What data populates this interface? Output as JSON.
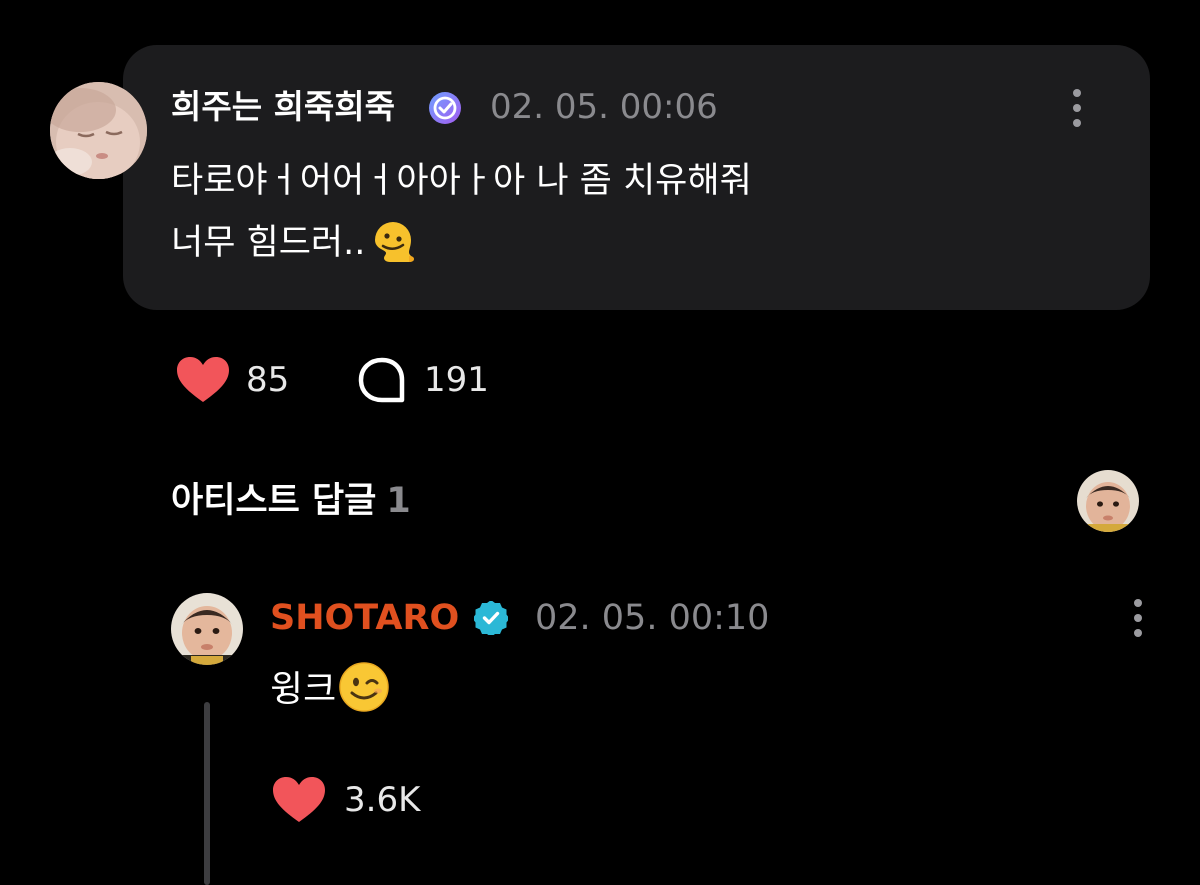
{
  "post": {
    "author": "희주는 희죽희죽",
    "verified_icon": "verified-badge-icon",
    "verified_color": "#7c6cf5",
    "timestamp": "02. 05. 00:06",
    "body_line1": "타로야ㅓ어어ㅓ아아ㅏ아 나 좀 치유해줘",
    "body_line2": "너무 힘드러..",
    "emoji": "melting-face-emoji",
    "like_count": "85",
    "comment_count": "191"
  },
  "artist_replies": {
    "title": "아티스트 답글",
    "count": "1"
  },
  "reply": {
    "author": "SHOTARO",
    "author_color": "#e0501f",
    "verified_color": "#2bb8d6",
    "timestamp": "02. 05. 00:10",
    "body": "윙크",
    "emoji": "winking-face-emoji",
    "like_count": "3.6K"
  },
  "colors": {
    "background": "#000000",
    "card": "#1c1c1e",
    "heart": "#f2555a",
    "muted_text": "#8a8a8e"
  }
}
